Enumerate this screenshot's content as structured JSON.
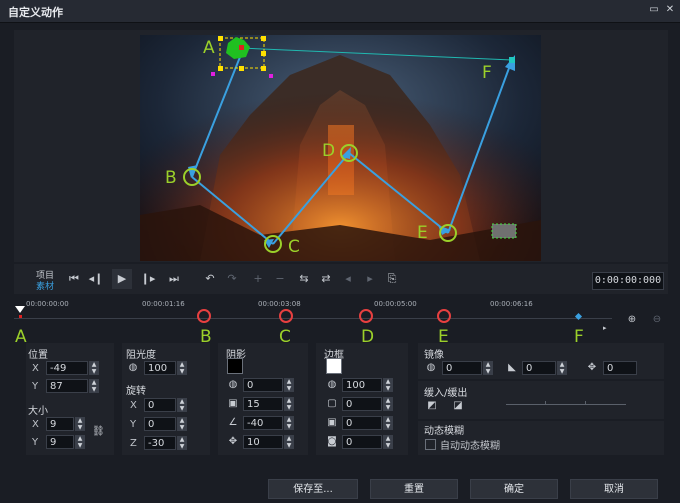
{
  "window": {
    "title": "自定义动作",
    "maximize_icon": "maximize-icon",
    "close_icon": "close-icon"
  },
  "transport": {
    "mode_project": "项目",
    "mode_clip": "素材",
    "timecode": "0:00:00:000"
  },
  "timeline": {
    "ticks": [
      "00:00:00:00",
      "00:00:01:16",
      "00:00:03:08",
      "00:00:05:00",
      "00:00:06:16"
    ]
  },
  "annotations": {
    "preview": [
      "A",
      "B",
      "C",
      "D",
      "E",
      "F"
    ],
    "timeline": [
      "A",
      "B",
      "C",
      "D",
      "E",
      "F"
    ]
  },
  "position": {
    "title": "位置",
    "x_label": "X",
    "x": "-49",
    "y_label": "Y",
    "y": "87"
  },
  "size": {
    "title": "大小",
    "x_label": "X",
    "x": "9",
    "y_label": "Y",
    "y": "9"
  },
  "opacity": {
    "title": "阻光度",
    "value": "100"
  },
  "rotation": {
    "title": "旋转",
    "x_label": "X",
    "x": "0",
    "y_label": "Y",
    "y": "0",
    "z_label": "Z",
    "z": "-30"
  },
  "shadow": {
    "title": "阴影",
    "color": "#000000",
    "opacity": "0",
    "blur": "15",
    "angle": "-40",
    "distance": "10"
  },
  "border": {
    "title": "边框",
    "color": "#ffffff",
    "opacity": "100",
    "width": "0",
    "blur": "0",
    "corner": "0"
  },
  "mirror": {
    "title": "镜像",
    "opacity": "0",
    "fade": "0",
    "offset": "0"
  },
  "ease": {
    "title": "缓入/缓出"
  },
  "motion_blur": {
    "title": "动态模糊",
    "checkbox_label": "自动动态模糊",
    "checked": false
  },
  "footer": {
    "save_as": "保存至...",
    "reset": "重置",
    "ok": "确定",
    "cancel": "取消"
  }
}
